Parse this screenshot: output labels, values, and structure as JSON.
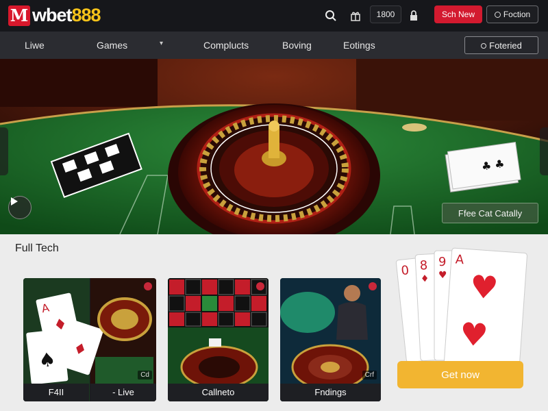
{
  "header": {
    "logo_badge": "M",
    "logo_word": "wbet",
    "logo_number": "888",
    "balance": "1800",
    "join_label": "Sch New",
    "position_label": "Foction",
    "icons": [
      "search-icon",
      "gift-icon",
      "lock-icon",
      "user-icon"
    ]
  },
  "nav": {
    "items": [
      "Liwe",
      "Games",
      "Complucts",
      "Boving",
      "Eotings"
    ],
    "featured_label": "Foteried",
    "featured_icon": "search-icon"
  },
  "hero": {
    "cta_label": "Ffee Cat Catally"
  },
  "section": {
    "title": "Full Tech"
  },
  "cards": [
    {
      "label": "F4II",
      "tag": ""
    },
    {
      "label": "- Live",
      "tag": "Cd"
    },
    {
      "label": "Callneto",
      "tag": ""
    },
    {
      "label": "Fndings",
      "tag": "Crf"
    }
  ],
  "promo": {
    "button_label": "Get now",
    "card_ranks": [
      "0",
      "8",
      "9",
      "A"
    ]
  },
  "colors": {
    "brand_red": "#d31a2f",
    "brand_gold": "#f2b531",
    "felt_green": "#1f6b2a"
  }
}
